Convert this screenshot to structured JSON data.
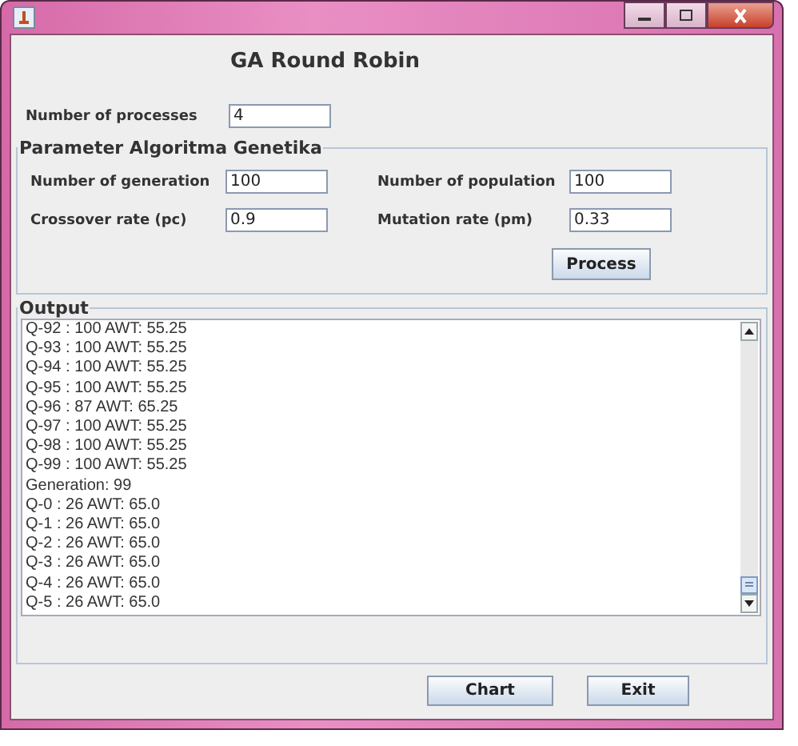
{
  "title": "GA Round Robin",
  "processes": {
    "label": "Number of processes",
    "value": "4"
  },
  "parameters": {
    "title": "Parameter Algoritma Genetika",
    "fields": [
      {
        "label": "Number of generation",
        "value": "100"
      },
      {
        "label": "Number of population",
        "value": "100"
      },
      {
        "label": "Crossover rate (pc)",
        "value": "0.9"
      },
      {
        "label": "Mutation rate (pm)",
        "value": "0.33"
      }
    ],
    "button": "Process"
  },
  "output": {
    "title": "Output",
    "lines": [
      "Q-92 : 100 AWT: 55.25",
      "Q-93 : 100 AWT: 55.25",
      "Q-94 : 100 AWT: 55.25",
      "Q-95 : 100 AWT: 55.25",
      "Q-96 : 87 AWT: 65.25",
      "Q-97 : 100 AWT: 55.25",
      "Q-98 : 100 AWT: 55.25",
      "Q-99 : 100 AWT: 55.25",
      "Generation: 99",
      "Q-0 : 26 AWT: 65.0",
      "Q-1 : 26 AWT: 65.0",
      "Q-2 : 26 AWT: 65.0",
      "Q-3 : 26 AWT: 65.0",
      "Q-4 : 26 AWT: 65.0",
      "Q-5 : 26 AWT: 65.0"
    ]
  },
  "buttons": [
    "Chart",
    "Exit"
  ]
}
